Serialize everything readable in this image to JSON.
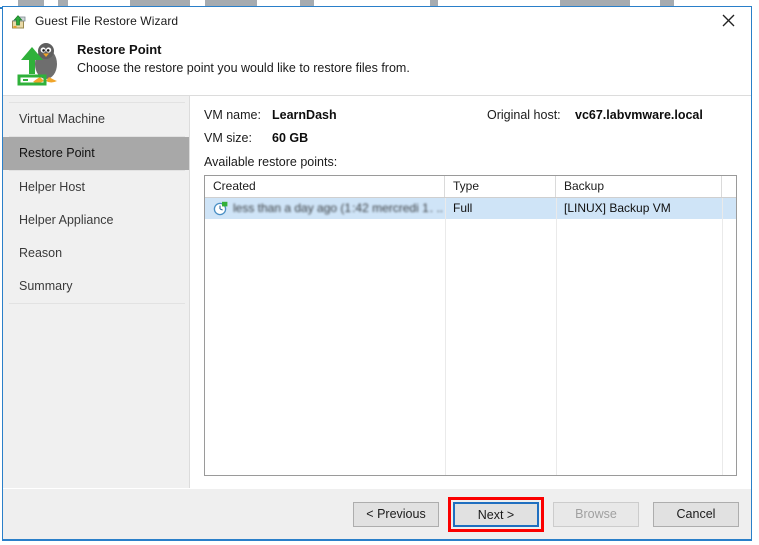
{
  "window": {
    "title": "Guest File Restore Wizard",
    "title_icon": "restore-upload-icon",
    "close_icon": "close-icon",
    "accent_color": "#2a7fc9"
  },
  "header": {
    "icon": "linux-penguin-restore-icon",
    "title": "Restore Point",
    "subtitle": "Choose the restore point you would like to restore files from."
  },
  "sidebar": {
    "items": [
      {
        "label": "Virtual Machine",
        "selected": false
      },
      {
        "label": "Restore Point",
        "selected": true
      },
      {
        "label": "Helper Host",
        "selected": false
      },
      {
        "label": "Helper Appliance",
        "selected": false
      },
      {
        "label": "Reason",
        "selected": false
      },
      {
        "label": "Summary",
        "selected": false
      }
    ],
    "selected_bg": "#a8a8a8"
  },
  "vm_info": {
    "vm_name_label": "VM name:",
    "vm_name_value": "LearnDash",
    "original_host_label": "Original host:",
    "original_host_value": "vc67.labvmware.local",
    "vm_size_label": "VM size:",
    "vm_size_value": "60 GB"
  },
  "restore_points": {
    "section_label": "Available restore points:",
    "columns": [
      "Created",
      "Type",
      "Backup"
    ],
    "rows": [
      {
        "icon": "restore-point-clock-icon",
        "created": "less than a day ago (1 :42 mercredi 1 . ..",
        "type": "Full",
        "backup": "[LINUX] Backup VM",
        "selected": true
      }
    ],
    "selected_row_bg": "#cfe4f7"
  },
  "footer": {
    "buttons": [
      {
        "label": "< Previous",
        "state": "enabled",
        "focused": false,
        "highlighted": false
      },
      {
        "label": "Next >",
        "state": "enabled",
        "focused": true,
        "highlighted": true
      },
      {
        "label": "Browse",
        "state": "disabled",
        "focused": false,
        "highlighted": false
      },
      {
        "label": "Cancel",
        "state": "enabled",
        "focused": false,
        "highlighted": false
      }
    ],
    "highlight_color": "#fb0000",
    "focus_color": "#1f6fc0"
  }
}
